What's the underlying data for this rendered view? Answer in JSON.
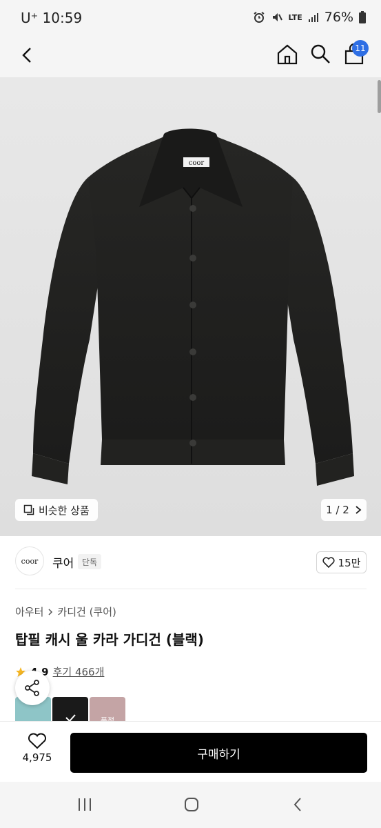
{
  "status": {
    "carrier": "U⁺ 10:59",
    "network": "LTE",
    "battery": "76%"
  },
  "header": {
    "cart_count": "11"
  },
  "gallery": {
    "similar_label": "비슷한 상품",
    "pager_text": "1 / 2",
    "product_brand_label": "coor"
  },
  "brand": {
    "logo_text": "coor",
    "name": "쿠어",
    "tag": "단독",
    "likes": "15만"
  },
  "product": {
    "breadcrumb": [
      "아우터",
      "카디건 (쿠어)"
    ],
    "title": "탑필 캐시 울 카라 가디건 (블랙)",
    "rating": "4.9",
    "reviews": "후기 466개",
    "colors": [
      {
        "name": "mint",
        "color": "#8ec5c7",
        "label": ""
      },
      {
        "name": "black",
        "color": "#1a1a1a",
        "label": ""
      },
      {
        "name": "pink",
        "color": "#c4a4a5",
        "label": "품절"
      }
    ]
  },
  "actions": {
    "like_count": "4,975",
    "buy_label": "구매하기"
  },
  "colors": {
    "accent": "#2f6fe4",
    "buy_bg": "#000000",
    "star": "#f5b623"
  }
}
